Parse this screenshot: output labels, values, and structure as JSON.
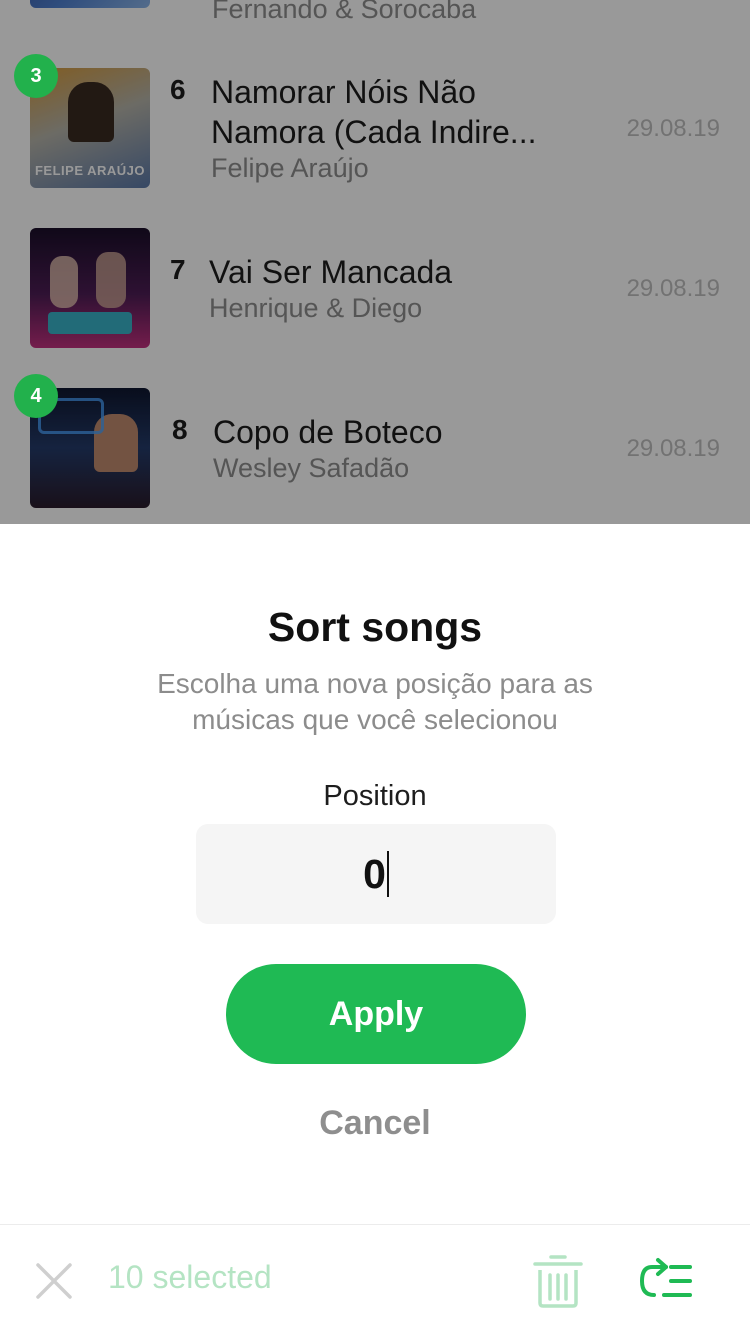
{
  "list": {
    "partial_row": {
      "artist": "Fernando & Sorocaba"
    },
    "rows": [
      {
        "badge": "3",
        "number": "6",
        "title": "Namorar Nóis Não Namora (Cada Indire...",
        "artist": "Felipe Araújo",
        "date": "29.08.19",
        "cover_text": "FELIPE ARAÚJO"
      },
      {
        "badge": "",
        "number": "7",
        "title": "Vai Ser Mancada",
        "artist": "Henrique & Diego",
        "date": "29.08.19",
        "cover_text": ""
      },
      {
        "badge": "4",
        "number": "8",
        "title": "Copo de Boteco",
        "artist": "Wesley Safadão",
        "date": "29.08.19",
        "cover_text": ""
      }
    ]
  },
  "sheet": {
    "title": "Sort songs",
    "subtitle": "Escolha uma nova posição para as músicas que você selecionou",
    "position_label": "Position",
    "position_value": "0",
    "apply_label": "Apply",
    "cancel_label": "Cancel"
  },
  "bottom_bar": {
    "selected_text": "10 selected",
    "icons": [
      "close-icon",
      "trash-icon",
      "reorder-icon"
    ]
  },
  "colors": {
    "accent": "#1fba54",
    "accent_light": "#b4e4c3",
    "badge": "#22b14c"
  }
}
